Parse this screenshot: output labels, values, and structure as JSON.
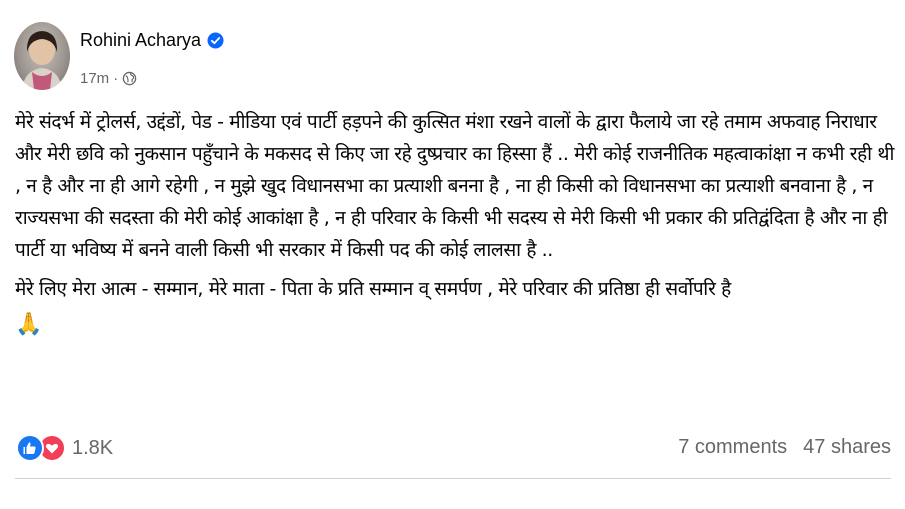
{
  "post": {
    "author_name": "Rohini Acharya",
    "time": "17m",
    "separator": "·",
    "paragraphs": [
      "मेरे संदर्भ में ट्रोलर्स, उद्दंडों, पेड - मीडिया एवं पार्टी हड़पने की कुत्सित मंशा रखने वालों के द्वारा फैलाये जा रहे तमाम अफवाह निराधार और मेरी छवि को नुकसान पहुँचाने के मकसद से किए जा रहे दुष्प्रचार का हिस्सा हैं .. मेरी कोई राजनीतिक महत्वाकांक्षा न कभी रही थी , न है और ना ही आगे रहेगी , न मुझे खुद विधानसभा का प्रत्याशी बनना है , ना ही किसी को विधानसभा का प्रत्याशी बनवाना है , न राज्यसभा की सदस्ता की मेरी कोई आकांक्षा है , न ही परिवार के किसी भी सदस्य से मेरी किसी भी प्रकार की प्रतिद्वंदिता है और ना ही पार्टी या भविष्य में बनने वाली किसी भी सरकार में किसी पद की कोई लालसा है ..",
      "मेरे लिए मेरा आत्म - सम्मान, मेरे माता - पिता के प्रति सम्मान व् समर्पण , मेरे परिवार की प्रतिष्ठा ही सर्वोपरि है"
    ],
    "emoji": "🙏",
    "reaction_count": "1.8K",
    "comments": "7 comments",
    "shares": "47 shares"
  },
  "colors": {
    "like_blue": "#1877f2",
    "love_red": "#f33e58",
    "secondary_text": "#65676b",
    "verified_blue": "#0866ff"
  },
  "icons": [
    "avatar",
    "verified-badge-icon",
    "globe-icon",
    "like-reaction-icon",
    "love-reaction-icon",
    "folded-hands-emoji"
  ]
}
